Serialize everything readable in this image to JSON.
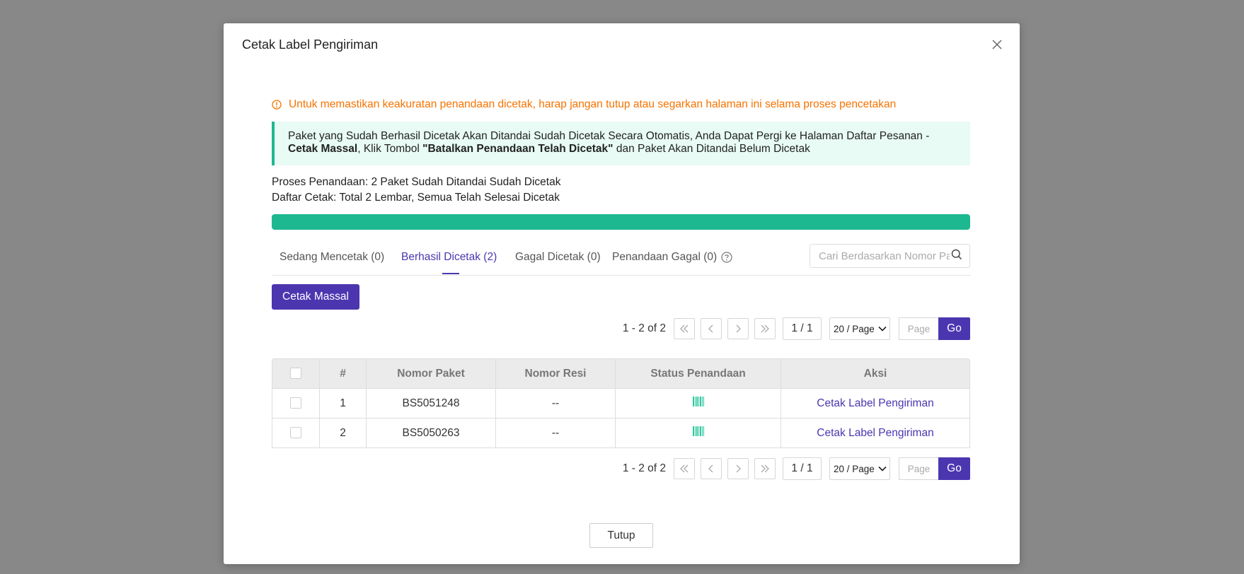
{
  "modal": {
    "title": "Cetak Label Pengiriman",
    "warning": "Untuk memastikan keakuratan penandaan dicetak, harap jangan tutup atau segarkan halaman ini selama proses pencetakan",
    "info": {
      "part1": "Paket yang Sudah Berhasil Dicetak Akan Ditandai Sudah Dicetak Secara Otomatis, Anda Dapat Pergi ke Halaman Daftar Pesanan -",
      "bold1": "Cetak Massal",
      "part2": ", Klik Tombol ",
      "bold2": "\"Batalkan Penandaan Telah Dicetak\"",
      "part3": " dan Paket Akan Ditandai Belum Dicetak"
    },
    "progress_line1": "Proses Penandaan: 2 Paket Sudah Ditandai Sudah Dicetak",
    "progress_line2": "Daftar Cetak: Total 2 Lembar, Semua Telah Selesai Dicetak",
    "progress_percent": 100,
    "tabs": [
      {
        "label": "Sedang Mencetak (0)"
      },
      {
        "label": "Berhasil Dicetak (2)"
      },
      {
        "label": "Gagal Dicetak (0)"
      },
      {
        "label": "Penandaan Gagal (0)"
      }
    ],
    "active_tab": 1,
    "search_placeholder": "Cari Berdasarkan Nomor Paket",
    "bulk_print_label": "Cetak Massal",
    "pagination": {
      "range": "1 - 2 of 2",
      "page_display": "1 / 1",
      "per_page": "20 / Page",
      "page_placeholder": "Page",
      "go_label": "Go"
    },
    "table": {
      "headers": [
        "#",
        "Nomor Paket",
        "Nomor Resi",
        "Status Penandaan",
        "Aksi"
      ],
      "rows": [
        {
          "index": "1",
          "package": "BS5051248",
          "receipt": "--",
          "action": "Cetak Label Pengiriman"
        },
        {
          "index": "2",
          "package": "BS5050263",
          "receipt": "--",
          "action": "Cetak Label Pengiriman"
        }
      ]
    },
    "close_label": "Tutup"
  },
  "colors": {
    "primary": "#4b36b0",
    "success": "#1db88f",
    "warning": "#f57300"
  }
}
